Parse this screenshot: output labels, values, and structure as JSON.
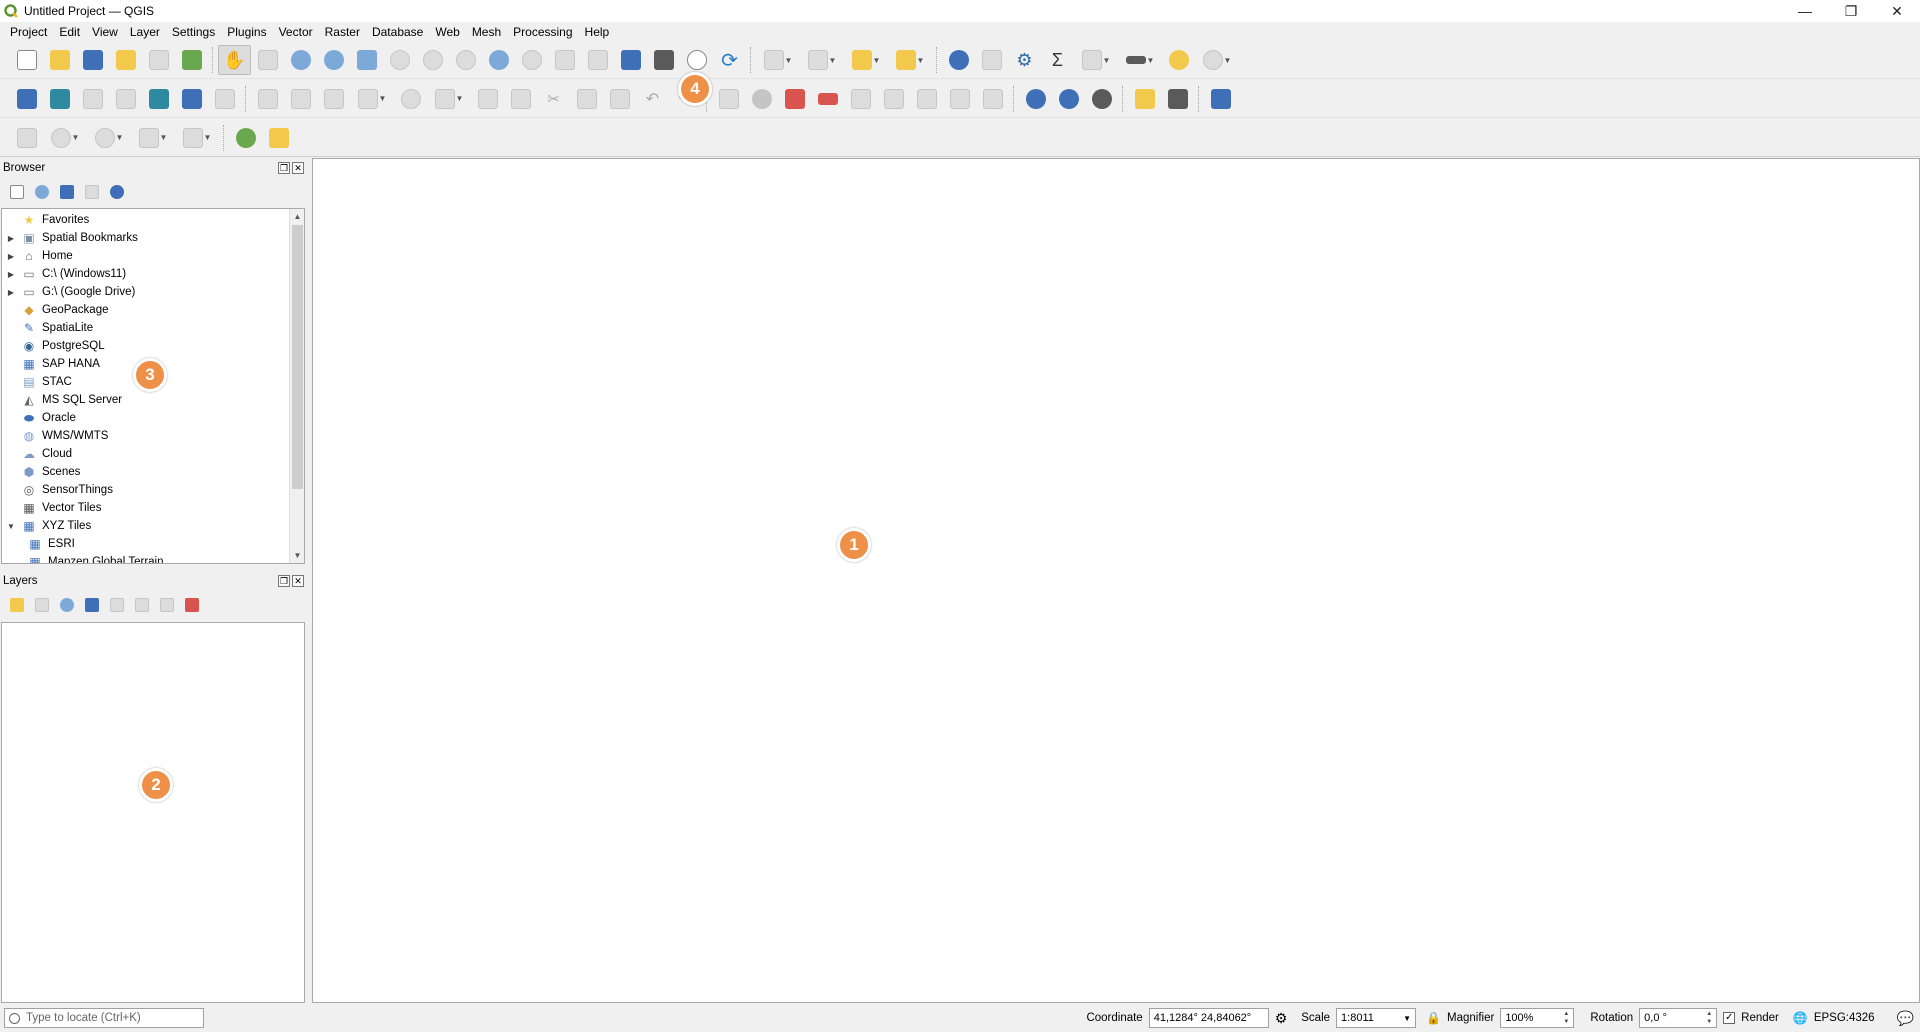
{
  "window": {
    "title": "Untitled Project — QGIS",
    "controls": [
      "—",
      "❐",
      "✕"
    ]
  },
  "menu": [
    "Project",
    "Edit",
    "View",
    "Layer",
    "Settings",
    "Plugins",
    "Vector",
    "Raster",
    "Database",
    "Web",
    "Mesh",
    "Processing",
    "Help"
  ],
  "browser": {
    "title": "Browser",
    "items": [
      {
        "label": "Favorites",
        "icon": "star-icon",
        "arrow": ""
      },
      {
        "label": "Spatial Bookmarks",
        "icon": "bookmark-icon",
        "arrow": "▶"
      },
      {
        "label": "Home",
        "icon": "home-folder-icon",
        "arrow": "▶"
      },
      {
        "label": "C:\\ (Windows11)",
        "icon": "folder-icon",
        "arrow": "▶"
      },
      {
        "label": "G:\\ (Google Drive)",
        "icon": "folder-icon",
        "arrow": "▶"
      },
      {
        "label": "GeoPackage",
        "icon": "geopackage-icon",
        "arrow": ""
      },
      {
        "label": "SpatiaLite",
        "icon": "spatialite-icon",
        "arrow": ""
      },
      {
        "label": "PostgreSQL",
        "icon": "postgresql-icon",
        "arrow": ""
      },
      {
        "label": "SAP HANA",
        "icon": "sap-hana-icon",
        "arrow": ""
      },
      {
        "label": "STAC",
        "icon": "stac-icon",
        "arrow": ""
      },
      {
        "label": "MS SQL Server",
        "icon": "mssql-icon",
        "arrow": ""
      },
      {
        "label": "Oracle",
        "icon": "oracle-icon",
        "arrow": ""
      },
      {
        "label": "WMS/WMTS",
        "icon": "wms-icon",
        "arrow": ""
      },
      {
        "label": "Cloud",
        "icon": "cloud-icon",
        "arrow": ""
      },
      {
        "label": "Scenes",
        "icon": "scenes-icon",
        "arrow": ""
      },
      {
        "label": "SensorThings",
        "icon": "sensorthings-icon",
        "arrow": ""
      },
      {
        "label": "Vector Tiles",
        "icon": "vector-tiles-icon",
        "arrow": ""
      },
      {
        "label": "XYZ Tiles",
        "icon": "xyz-tiles-icon",
        "arrow": "▼"
      },
      {
        "label": "ESRI",
        "icon": "xyz-tiles-icon",
        "arrow": "",
        "child": true
      },
      {
        "label": "Mapzen Global Terrain",
        "icon": "xyz-tiles-icon",
        "arrow": "",
        "child": true
      }
    ]
  },
  "layers": {
    "title": "Layers"
  },
  "callouts": [
    "1",
    "2",
    "3",
    "4"
  ],
  "status": {
    "locator_placeholder": "Type to locate (Ctrl+K)",
    "coordinate_label": "Coordinate",
    "coordinate_value": "41,1284° 24,84062°",
    "scale_label": "Scale",
    "scale_value": "1:8011",
    "magnifier_label": "Magnifier",
    "magnifier_value": "100%",
    "rotation_label": "Rotation",
    "rotation_value": "0,0 °",
    "render_label": "Render",
    "crs": "EPSG:4326"
  },
  "colors": {
    "callout": "#ee9048",
    "canvas": "#ffffff",
    "chrome": "#f0f0f0"
  }
}
